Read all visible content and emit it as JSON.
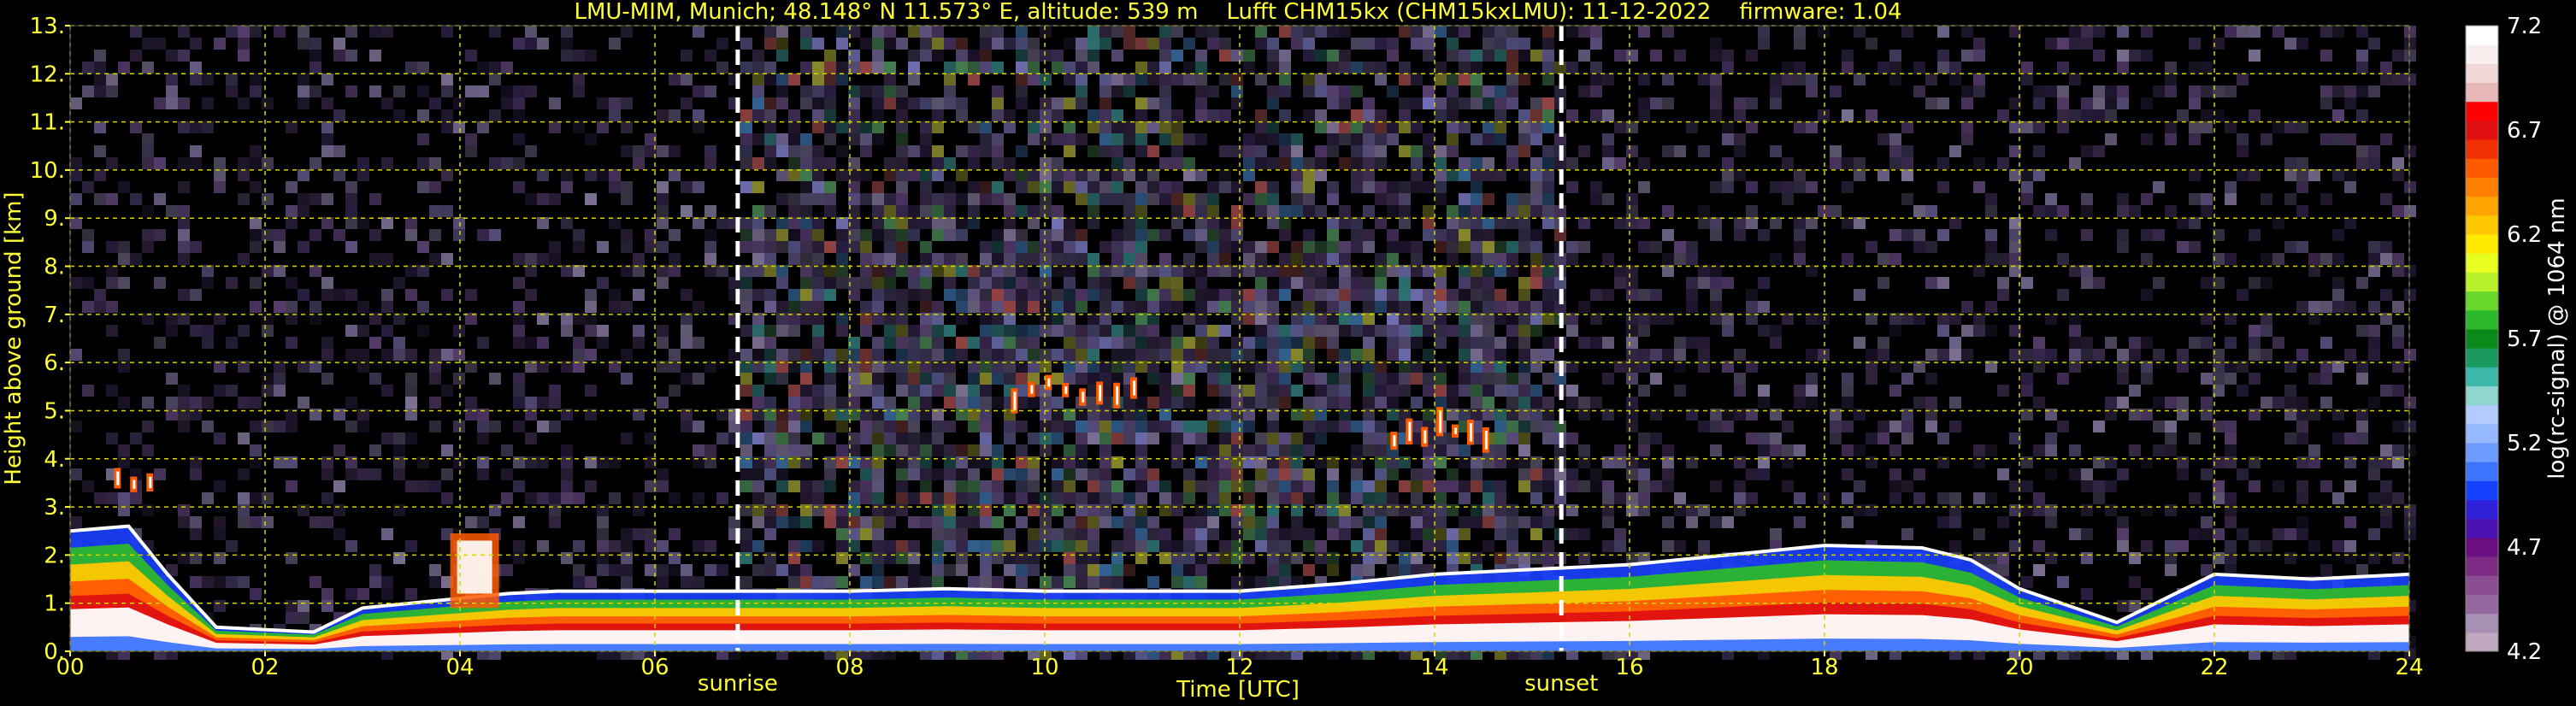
{
  "title": "LMU-MIM, Munich; 48.148° N 11.573° E, altitude: 539 m    Lufft CHM15kx (CHM15kxLMU): 11-12-2022    firmware: 1.04",
  "colors": {
    "background": "#000000",
    "axis_text": "#ffff33",
    "grid": "#d4d400",
    "event_line": "#ffffff"
  },
  "chart_data": {
    "type": "heatmap",
    "title": "LMU-MIM, Munich; 48.148° N 11.573° E, altitude: 539 m    Lufft CHM15kx (CHM15kxLMU): 11-12-2022    firmware: 1.04",
    "xlabel": "Time [UTC]",
    "ylabel": "Height above ground [km]",
    "xlim": [
      0,
      24
    ],
    "ylim": [
      0,
      13
    ],
    "xticks": [
      0,
      2,
      4,
      6,
      8,
      10,
      12,
      14,
      16,
      18,
      20,
      22,
      24
    ],
    "xtick_labels": [
      "00",
      "02",
      "04",
      "06",
      "08",
      "10",
      "12",
      "14",
      "16",
      "18",
      "20",
      "22",
      "24"
    ],
    "yticks": [
      0,
      1,
      2,
      3,
      4,
      5,
      6,
      7,
      8,
      9,
      10,
      11,
      12,
      13
    ],
    "ytick_labels": [
      "0.",
      "1.",
      "2.",
      "3.",
      "4.",
      "5.",
      "6.",
      "7.",
      "8.",
      "9.",
      "10.",
      "11.",
      "12.",
      "13."
    ],
    "grid": true,
    "events": [
      {
        "label": "sunrise",
        "x": 6.85
      },
      {
        "label": "sunset",
        "x": 15.3
      }
    ],
    "colorbar": {
      "label": "log(rc-signal) @ 1064 nm",
      "range": [
        4.2,
        7.2
      ],
      "ticks": [
        4.2,
        4.7,
        5.2,
        5.7,
        6.2,
        6.7,
        7.2
      ],
      "tick_labels": [
        "4.2",
        "4.7",
        "5.2",
        "5.7",
        "6.2",
        "6.7",
        "7.2"
      ],
      "colors": [
        "#bfa8c0",
        "#a890b5",
        "#95699f",
        "#8a4d90",
        "#7d2a85",
        "#6a0f80",
        "#4a10b0",
        "#3020d8",
        "#1840ff",
        "#3d75ff",
        "#6b9bff",
        "#95b8ff",
        "#b3ccff",
        "#8fd6d0",
        "#3cb8a8",
        "#1a9a60",
        "#0a8a1a",
        "#2cb82c",
        "#6ad82a",
        "#b8f02a",
        "#e8ff20",
        "#ffea00",
        "#ffc800",
        "#ffa300",
        "#ff8000",
        "#ff5a00",
        "#f03000",
        "#e01010",
        "#ff0000",
        "#e8b8b8",
        "#f0d8d8",
        "#f8eeee",
        "#ffffff"
      ]
    },
    "signal_features": {
      "value_unit": "log(rc-signal)",
      "boundary_layer_top_km": [
        [
          0,
          2.5
        ],
        [
          0.6,
          2.6
        ],
        [
          1.0,
          1.6
        ],
        [
          1.5,
          0.5
        ],
        [
          2.5,
          0.4
        ],
        [
          3.0,
          0.9
        ],
        [
          4.0,
          1.1
        ],
        [
          4.5,
          1.2
        ],
        [
          5.0,
          1.25
        ],
        [
          6.0,
          1.25
        ],
        [
          7.0,
          1.25
        ],
        [
          8.0,
          1.25
        ],
        [
          9.0,
          1.3
        ],
        [
          10.0,
          1.25
        ],
        [
          11.0,
          1.25
        ],
        [
          12.0,
          1.25
        ],
        [
          13.0,
          1.4
        ],
        [
          14.0,
          1.6
        ],
        [
          15.0,
          1.7
        ],
        [
          16.0,
          1.8
        ],
        [
          17.0,
          2.0
        ],
        [
          18.0,
          2.2
        ],
        [
          19.0,
          2.15
        ],
        [
          19.5,
          1.9
        ],
        [
          20.0,
          1.3
        ],
        [
          21.0,
          0.6
        ],
        [
          22.0,
          1.6
        ],
        [
          23.0,
          1.5
        ],
        [
          24.0,
          1.6
        ]
      ],
      "residual_layer_km": [
        [
          3.9,
          2.1
        ],
        [
          4.4,
          2.0
        ]
      ],
      "elevated_cloud_patches": [
        {
          "t_start": 9.6,
          "t_end": 11.0,
          "h_bottom_km": 4.9,
          "h_top_km": 6.0
        },
        {
          "t_start": 13.5,
          "t_end": 14.6,
          "h_bottom_km": 4.1,
          "h_top_km": 5.1
        },
        {
          "t_start": 0.4,
          "t_end": 0.9,
          "h_bottom_km": 3.3,
          "h_top_km": 3.5
        }
      ]
    }
  }
}
